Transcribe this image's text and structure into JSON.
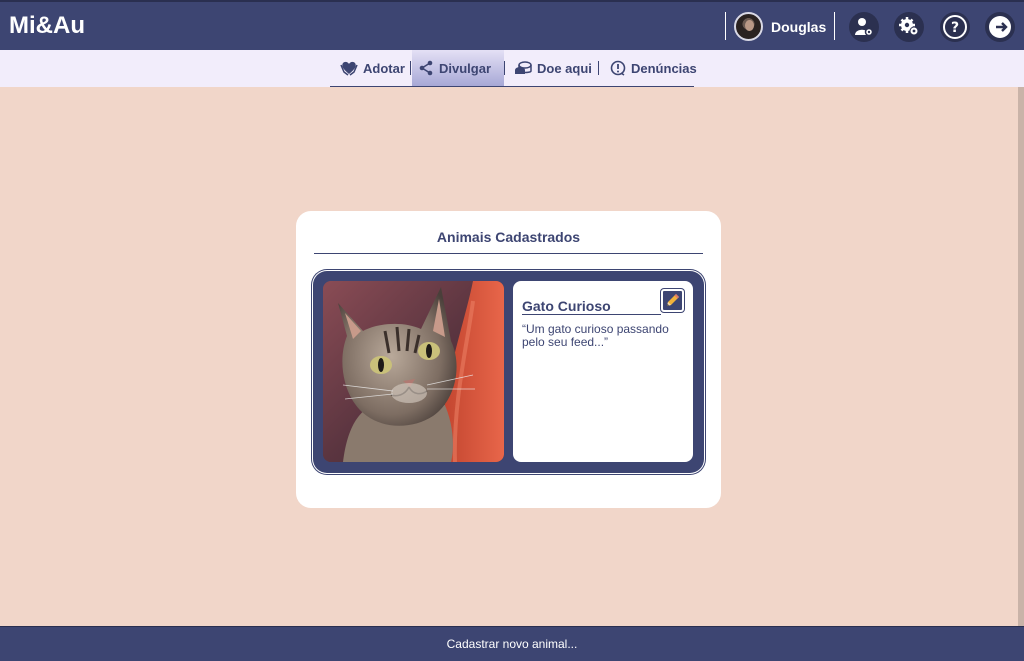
{
  "header": {
    "brand": "Mi&Au",
    "username": "Douglas",
    "icons": [
      "avatar",
      "user-settings-icon",
      "gears-icon",
      "help-icon",
      "logout-icon"
    ]
  },
  "nav": {
    "items": [
      {
        "label": "Adotar",
        "icon": "heart-hands-icon",
        "active": false
      },
      {
        "label": "Divulgar",
        "icon": "share-icon",
        "active": true
      },
      {
        "label": "Doe aqui",
        "icon": "coins-icon",
        "active": false
      },
      {
        "label": "Denúncias",
        "icon": "alert-icon",
        "active": false
      }
    ]
  },
  "main": {
    "card_title": "Animais Cadastrados",
    "animals": [
      {
        "name": "Gato Curioso",
        "description": "“Um gato curioso passando pelo seu feed...”"
      }
    ]
  },
  "footer": {
    "button_label": "Cadastrar novo animal..."
  },
  "colors": {
    "primary": "#3d4572",
    "background": "#f1d6c9",
    "nav_background": "#f2edfb",
    "card": "#ffffff"
  }
}
